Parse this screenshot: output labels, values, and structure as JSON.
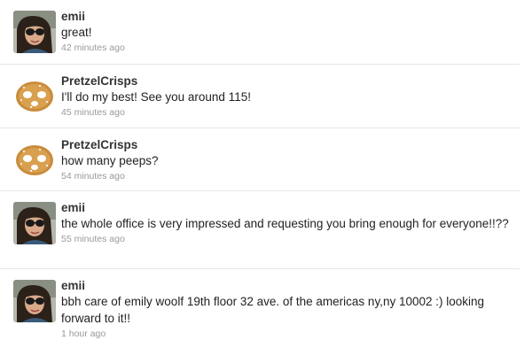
{
  "tweets": [
    {
      "user": "emii",
      "avatar": "girl-avatar",
      "text": "great!",
      "time": "42 minutes ago"
    },
    {
      "user": "PretzelCrisps",
      "avatar": "pretzel-avatar",
      "text": "I'll do my best! See you around 115!",
      "time": "45 minutes ago"
    },
    {
      "user": "PretzelCrisps",
      "avatar": "pretzel-avatar",
      "text": "how many peeps?",
      "time": "54 minutes ago"
    },
    {
      "user": "emii",
      "avatar": "girl-avatar",
      "text": "the whole office is very impressed and requesting you bring enough for everyone!!??",
      "time": "55 minutes ago"
    },
    {
      "user": "emii",
      "avatar": "girl-avatar",
      "text": "bbh care of emily woolf 19th floor 32 ave. of the americas ny,ny 10002 :) looking forward to it!!",
      "time": "1 hour ago"
    }
  ],
  "colors": {
    "text": "#222222",
    "username": "#333333",
    "timestamp": "#999999",
    "divider": "#e6e6e6"
  }
}
